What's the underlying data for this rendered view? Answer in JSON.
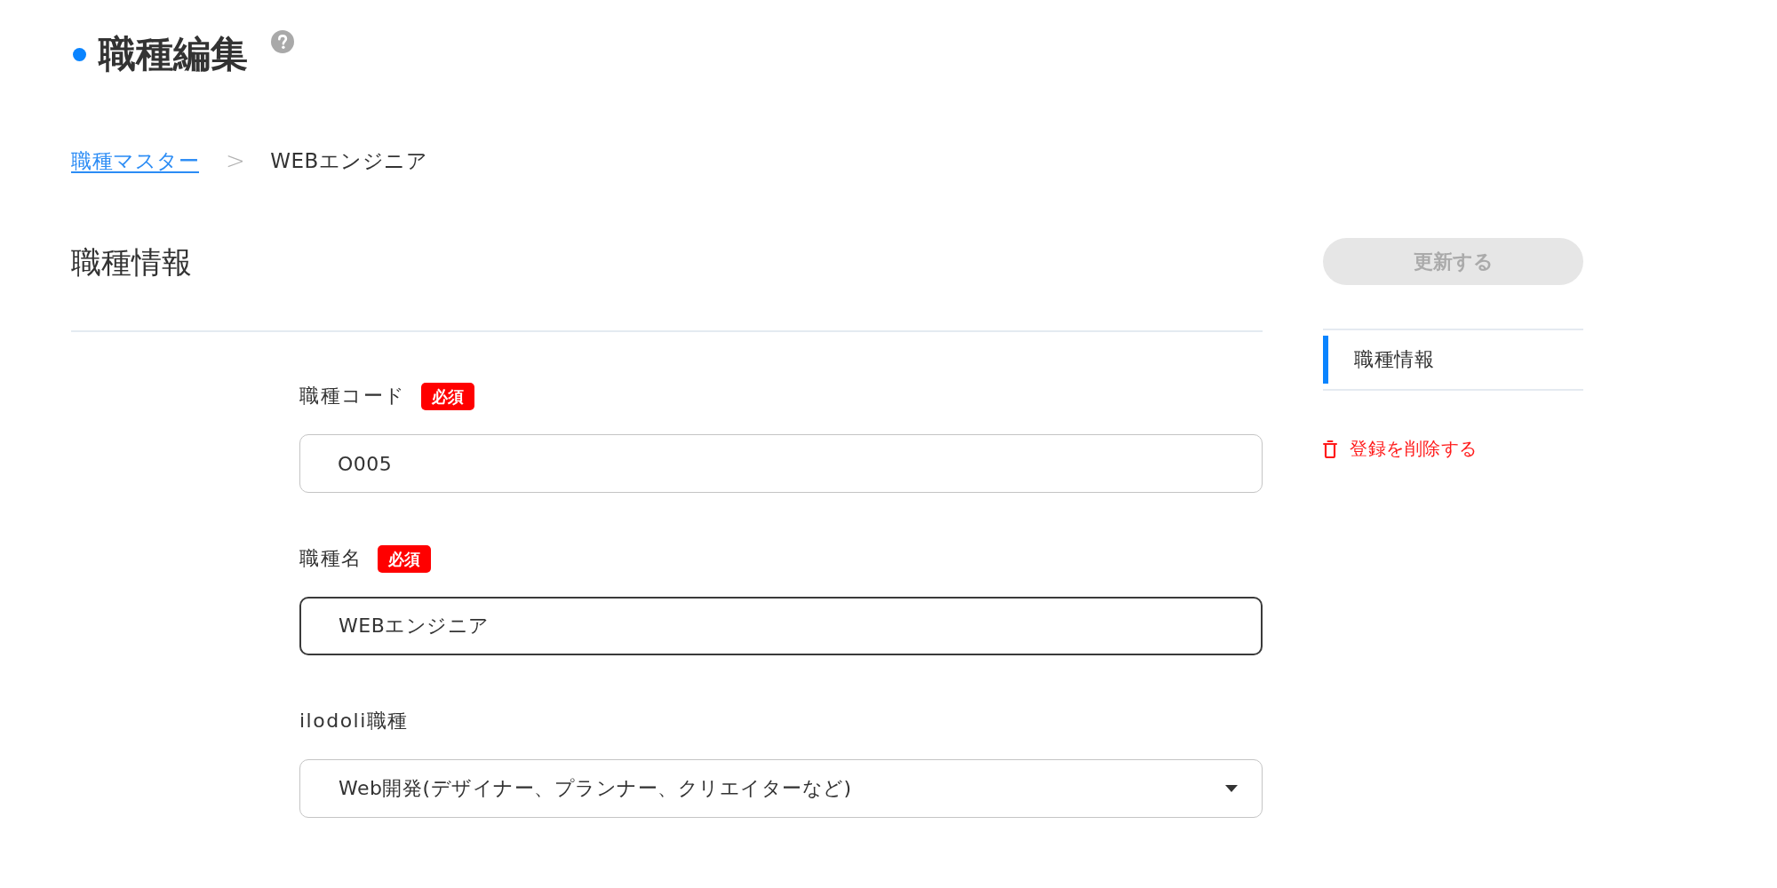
{
  "page": {
    "title": "職種編集"
  },
  "breadcrumb": {
    "link": "職種マスター",
    "separator": ">",
    "current": "WEBエンジニア"
  },
  "section": {
    "title": "職種情報"
  },
  "form": {
    "fields": [
      {
        "kind": "text",
        "label": "職種コード",
        "badge": "必須",
        "value": "O005",
        "focused": false
      },
      {
        "kind": "text",
        "label": "職種名",
        "badge": "必須",
        "value": "WEBエンジニア",
        "focused": true
      },
      {
        "kind": "select",
        "label": "ilodoli職種",
        "value": "Web開発(デザイナー、プランナー、クリエイターなど)",
        "focused": false
      }
    ]
  },
  "sidebar": {
    "update_button": {
      "label": "更新する",
      "disabled": true
    },
    "nav": [
      {
        "label": "職種情報",
        "selected": true
      }
    ],
    "delete_link": "登録を削除する"
  }
}
